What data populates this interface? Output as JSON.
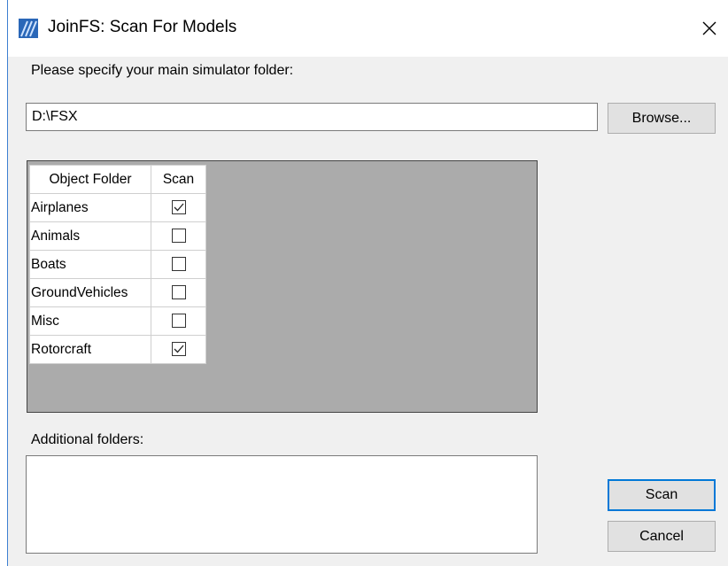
{
  "window": {
    "title": "JoinFS: Scan For Models",
    "icon": "joinfs-app-icon",
    "close_icon": "close-icon",
    "colors": {
      "border": "#3d7fd1",
      "accent": "#0078d7",
      "grid_background": "#ababab",
      "client": "#f0f0f0"
    }
  },
  "main_folder": {
    "label": "Please specify your main simulator folder:",
    "value": "D:\\FSX",
    "browse_label": "Browse..."
  },
  "grid": {
    "columns": [
      "Object Folder",
      "Scan"
    ],
    "rows": [
      {
        "folder": "Airplanes",
        "scan": true
      },
      {
        "folder": "Animals",
        "scan": false
      },
      {
        "folder": "Boats",
        "scan": false
      },
      {
        "folder": "GroundVehicles",
        "scan": false
      },
      {
        "folder": "Misc",
        "scan": false
      },
      {
        "folder": "Rotorcraft",
        "scan": true
      }
    ]
  },
  "additional": {
    "label": "Additional folders:",
    "value": ""
  },
  "actions": {
    "scan_label": "Scan",
    "cancel_label": "Cancel"
  }
}
